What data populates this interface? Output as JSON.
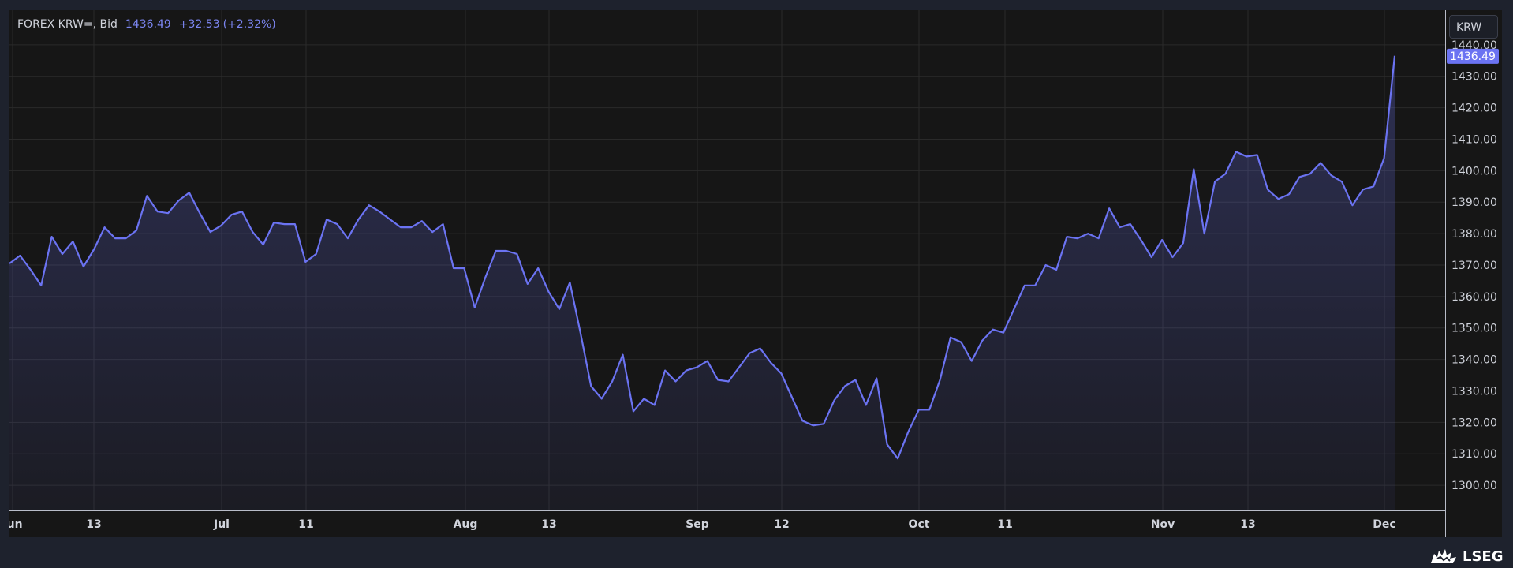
{
  "legend": {
    "instrument": "FOREX KRW=, Bid",
    "last": "1436.49",
    "change": "+32.53",
    "change_pct": "(+2.32%)"
  },
  "currency_button": "KRW",
  "brand": "LSEG",
  "colors": {
    "line": "#6b73f2",
    "background": "#161616",
    "grid": "#2a2a2a",
    "price_tag": "#6b73f2"
  },
  "chart_data": {
    "type": "area",
    "x_tick_labels": [
      "Jun",
      "13",
      "Jul",
      "11",
      "Aug",
      "13",
      "Sep",
      "12",
      "Oct",
      "11",
      "Nov",
      "13",
      "Dec"
    ],
    "y_ticks": [
      1300,
      1310,
      1320,
      1330,
      1340,
      1350,
      1360,
      1370,
      1380,
      1390,
      1400,
      1410,
      1420,
      1430,
      1440
    ],
    "y_tick_labels": [
      "1300.00",
      "1310.00",
      "1320.00",
      "1330.00",
      "1340.00",
      "1350.00",
      "1360.00",
      "1370.00",
      "1380.00",
      "1390.00",
      "1400.00",
      "1410.00",
      "1420.00",
      "1430.00",
      "1440.00"
    ],
    "ylim": [
      1292,
      1451
    ],
    "last_value_label": "1436.49",
    "grid": true,
    "series": [
      {
        "values": [
          1370.5,
          1373,
          1368.5,
          1363.5,
          1379,
          1373.5,
          1377.5,
          1369.5,
          1375,
          1382,
          1378.5,
          1378.5,
          1381,
          1392,
          1387,
          1386.5,
          1390.5,
          1393,
          1386.5,
          1380.5,
          1382.5,
          1386,
          1387,
          1380.5,
          1376.5,
          1383.5,
          1383,
          1383,
          1371,
          1373.5,
          1384.5,
          1383,
          1378.5,
          1384.5,
          1389,
          1387,
          1384.5,
          1382,
          1382,
          1384,
          1380.5,
          1383,
          1369,
          1369,
          1356.5,
          1366,
          1374.5,
          1374.5,
          1373.5,
          1364,
          1369,
          1361.5,
          1356,
          1364.5,
          1348.5,
          1331.5,
          1327.5,
          1333,
          1341.5,
          1323.5,
          1327.5,
          1325.5,
          1336.5,
          1333,
          1336.5,
          1337.5,
          1339.5,
          1333.5,
          1333,
          1337.5,
          1342,
          1343.5,
          1339,
          1335.5,
          1328,
          1320.5,
          1319,
          1319.5,
          1327,
          1331.5,
          1333.5,
          1325.5,
          1334,
          1313,
          1308.5,
          1317,
          1324,
          1324,
          1333.5,
          1347,
          1345.5,
          1339.5,
          1346,
          1349.5,
          1348.5,
          1356,
          1363.5,
          1363.5,
          1370,
          1368.5,
          1379,
          1378.5,
          1380,
          1378.5,
          1388,
          1382,
          1383,
          1378,
          1372.5,
          1378,
          1372.5,
          1377,
          1400.5,
          1380,
          1396.5,
          1399,
          1406,
          1404.5,
          1405,
          1394,
          1391,
          1392.5,
          1398,
          1399,
          1402.5,
          1398.5,
          1396.5,
          1389,
          1394,
          1395,
          1404,
          1436.5
        ]
      }
    ]
  }
}
